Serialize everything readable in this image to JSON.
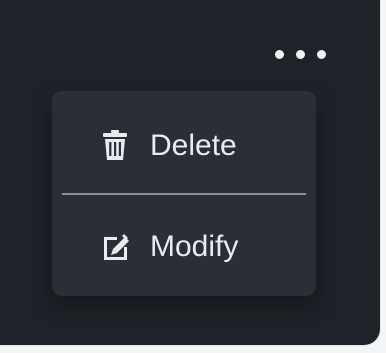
{
  "menu": {
    "items": [
      {
        "label": "Delete",
        "icon": "trash-icon"
      },
      {
        "label": "Modify",
        "icon": "edit-icon"
      }
    ]
  },
  "colors": {
    "card_background": "#1f2228",
    "menu_background": "#2a2f36",
    "text": "#e8ebef",
    "divider": "#8a8f97",
    "dots": "#f2f3f5"
  }
}
